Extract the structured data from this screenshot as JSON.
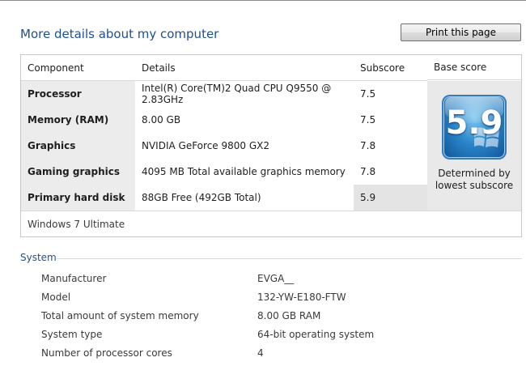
{
  "header": {
    "title": "More details about my computer",
    "print_label": "Print this page"
  },
  "scores": {
    "columns": [
      "Component",
      "Details",
      "Subscore",
      "Base score"
    ],
    "rows": [
      {
        "component": "Processor",
        "details": "Intel(R) Core(TM)2 Quad CPU Q9550 @ 2.83GHz",
        "subscore": "7.5"
      },
      {
        "component": "Memory (RAM)",
        "details": "8.00 GB",
        "subscore": "7.5"
      },
      {
        "component": "Graphics",
        "details": "NVIDIA GeForce 9800 GX2",
        "subscore": "7.8"
      },
      {
        "component": "Gaming graphics",
        "details": "4095 MB Total available graphics memory",
        "subscore": "7.8"
      },
      {
        "component": "Primary hard disk",
        "details": "88GB Free (492GB Total)",
        "subscore": "5.9"
      }
    ],
    "base_score": "5.9",
    "base_caption": "Determined by lowest subscore",
    "edition": "Windows 7 Ultimate",
    "colors": {
      "badge": "#2b85c9",
      "highlight": "#e4e4e4"
    }
  },
  "system": {
    "title": "System",
    "rows": [
      {
        "label": "Manufacturer",
        "value": "EVGA__"
      },
      {
        "label": "Model",
        "value": "132-YW-E180-FTW"
      },
      {
        "label": "Total amount of system memory",
        "value": "8.00 GB RAM"
      },
      {
        "label": "System type",
        "value": "64-bit operating system"
      },
      {
        "label": "Number of processor cores",
        "value": "4"
      }
    ]
  }
}
